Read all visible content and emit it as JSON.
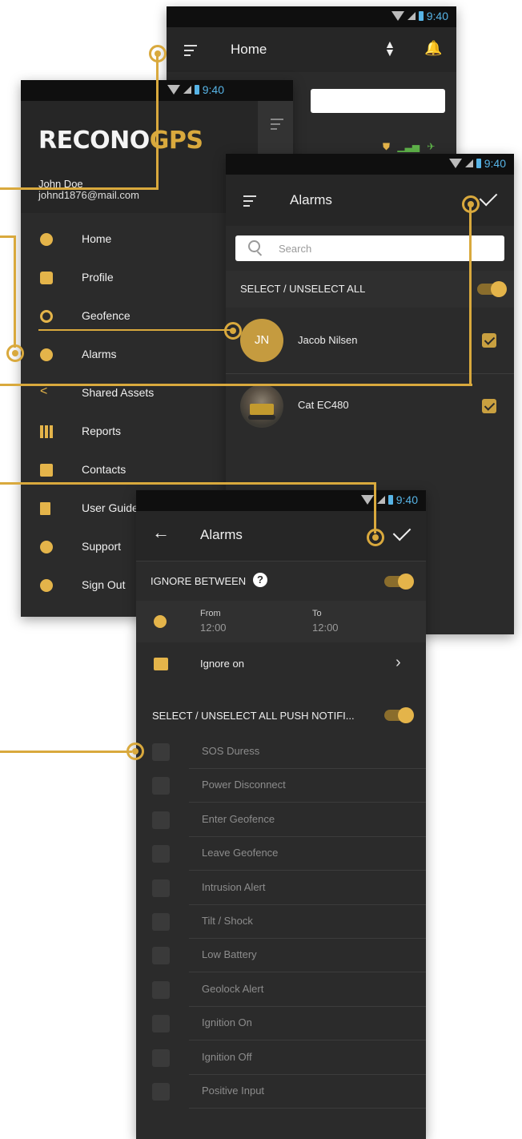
{
  "status": {
    "time": "9:40"
  },
  "home_screen": {
    "title": "Home"
  },
  "drawer": {
    "logo_main": "RECONO",
    "logo_accent": "GPS",
    "user_name": "John Doe",
    "user_email": "johnd1876@mail.com",
    "items": [
      {
        "label": "Home",
        "icon": "home-icon"
      },
      {
        "label": "Profile",
        "icon": "gear-icon"
      },
      {
        "label": "Geofence",
        "icon": "geofence-icon"
      },
      {
        "label": "Alarms",
        "icon": "alarm-icon"
      },
      {
        "label": "Shared Assets",
        "icon": "share-icon"
      },
      {
        "label": "Reports",
        "icon": "chart-icon"
      },
      {
        "label": "Contacts",
        "icon": "contact-icon"
      },
      {
        "label": "User Guide",
        "icon": "document-icon"
      },
      {
        "label": "Support",
        "icon": "info-icon"
      },
      {
        "label": "Sign Out",
        "icon": "power-icon"
      }
    ]
  },
  "alarms_list": {
    "title": "Alarms",
    "search_placeholder": "Search",
    "select_all_label": "SELECT / UNSELECT ALL",
    "contacts": [
      {
        "initials": "JN",
        "name": "Jacob Nilsen"
      },
      {
        "initials": "",
        "name": "Cat EC480"
      }
    ]
  },
  "alarm_settings": {
    "title": "Alarms",
    "ignore_between_label": "IGNORE BETWEEN",
    "help_glyph": "?",
    "from_label": "From",
    "from_value": "12:00",
    "to_label": "To",
    "to_value": "12:00",
    "ignore_on_label": "Ignore on",
    "push_label": "SELECT / UNSELECT ALL PUSH NOTIFI...",
    "notifications": [
      "SOS Duress",
      "Power Disconnect",
      "Enter Geofence",
      "Leave Geofence",
      "Intrusion Alert",
      "Tilt / Shock",
      "Low Battery",
      "Geolock Alert",
      "Ignition On",
      "Ignition Off",
      "Positive Input"
    ]
  },
  "colors": {
    "accent": "#d9a93d",
    "background": "#2b2b2b",
    "statusbar": "#0f0f0f"
  }
}
